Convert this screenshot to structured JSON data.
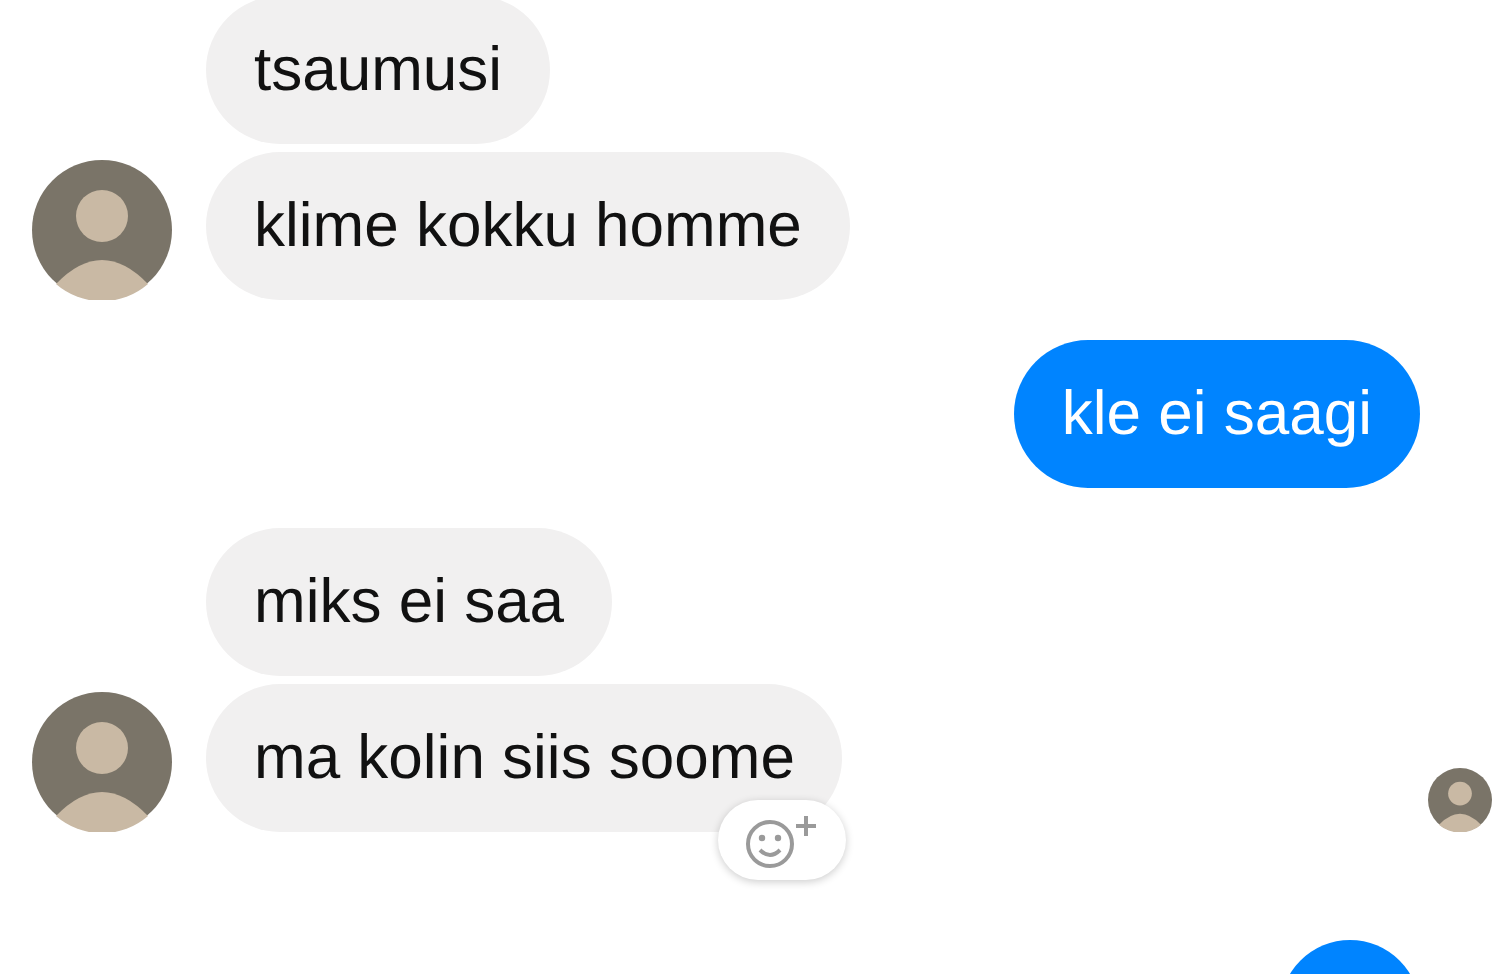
{
  "messages": [
    {
      "kind": "them",
      "text": "tsaumusi",
      "reaction_button": false,
      "read_receipt": false
    },
    {
      "kind": "them",
      "text": "klime kokku homme",
      "reaction_button": false,
      "read_receipt": false
    },
    {
      "kind": "me",
      "text": "kle ei saagi",
      "reaction_button": false,
      "read_receipt": false
    },
    {
      "kind": "them",
      "text": "miks ei saa",
      "reaction_button": false,
      "read_receipt": false
    },
    {
      "kind": "them",
      "text": "ma kolin siis soome",
      "reaction_button": true,
      "read_receipt": true
    },
    {
      "kind": "me",
      "reaction_button": false
    }
  ]
}
